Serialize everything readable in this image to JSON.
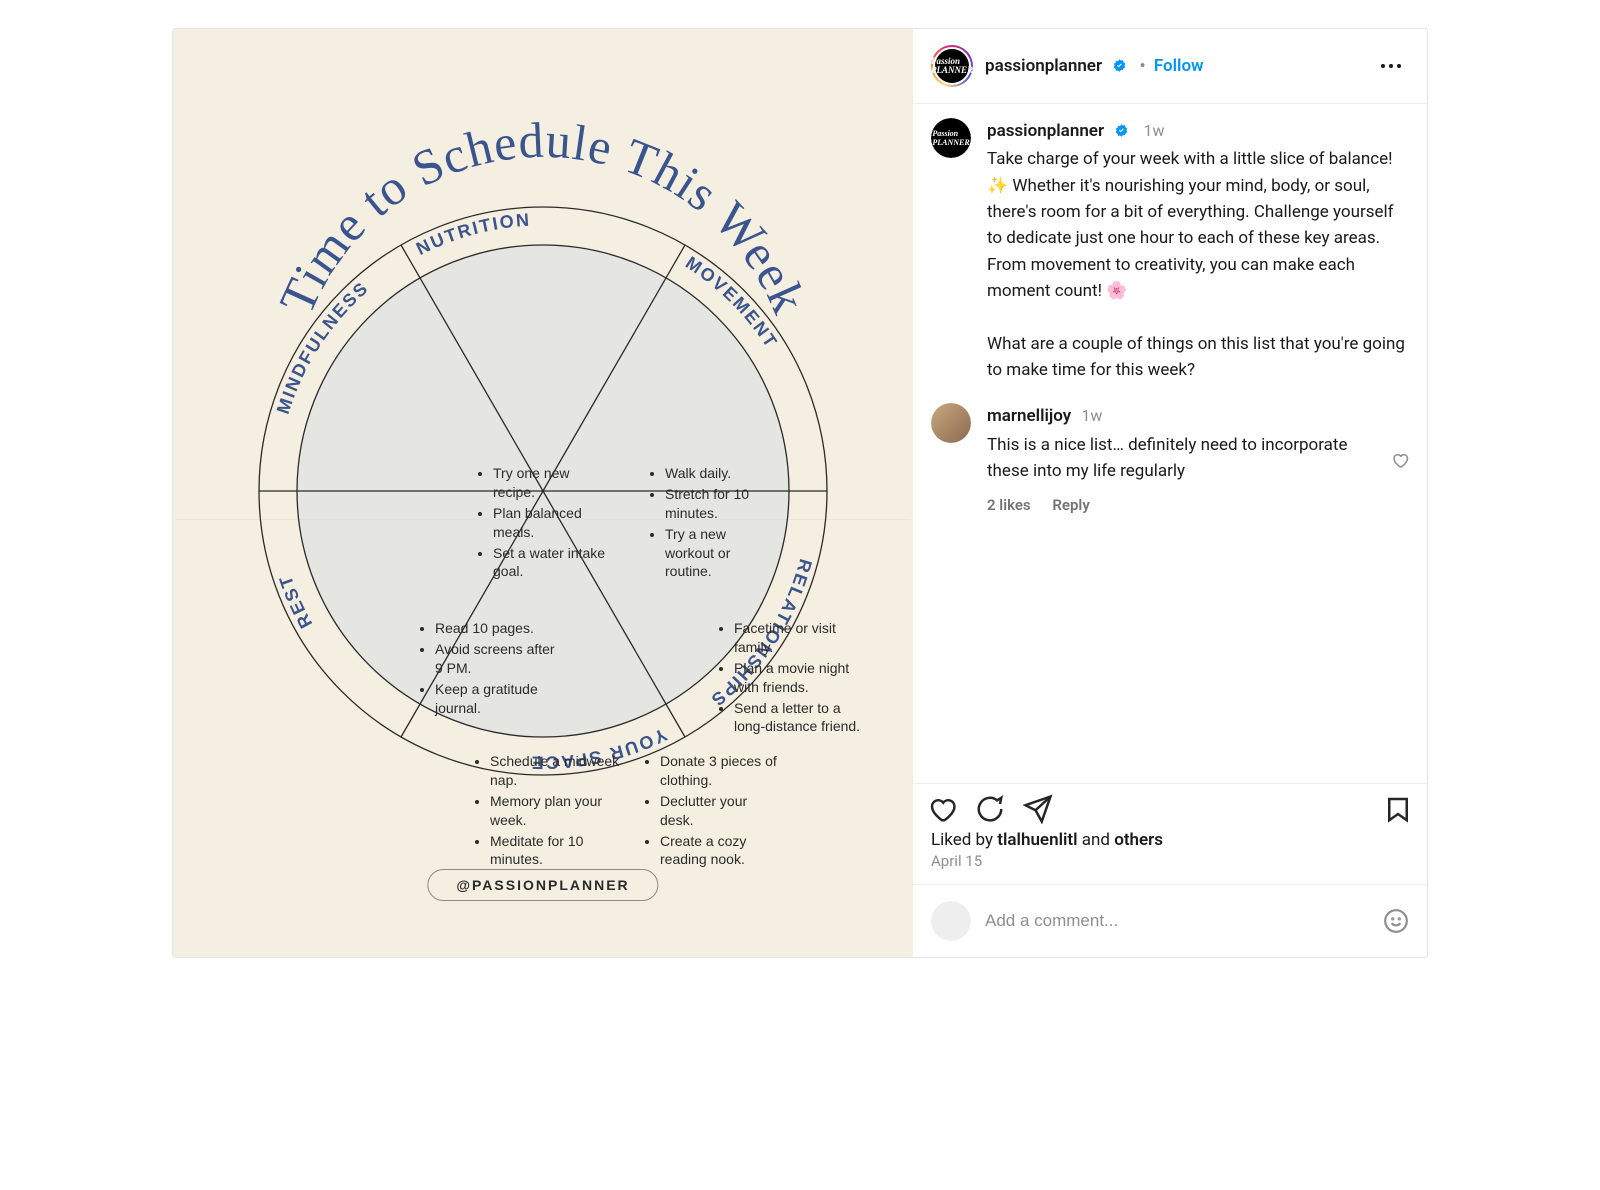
{
  "header": {
    "username": "passionplanner",
    "follow": "Follow",
    "avatar_text": "Passion PLANNER"
  },
  "image": {
    "title": "Time to Schedule This Week",
    "handle": "@PASSIONPLANNER",
    "segments": {
      "nutrition": {
        "label": "NUTRITION",
        "items": [
          "Try one new recipe.",
          "Plan balanced meals.",
          "Set a water intake goal."
        ]
      },
      "movement": {
        "label": "MOVEMENT",
        "items": [
          "Walk daily.",
          "Stretch for 10 minutes.",
          "Try a new workout or routine."
        ]
      },
      "relationships": {
        "label": "RELATIONSHIPS",
        "items": [
          "Facetime or visit family.",
          "Plan a movie night with friends.",
          "Send a letter to a long-distance friend."
        ]
      },
      "yourspace": {
        "label": "YOUR SPACE",
        "items": [
          "Donate 3 pieces of clothing.",
          "Declutter your desk.",
          "Create a cozy reading nook."
        ]
      },
      "rest": {
        "label": "REST",
        "items": [
          "Schedule a midweek nap.",
          "Memory plan your week.",
          "Meditate for 10 minutes."
        ]
      },
      "mindfulness": {
        "label": "MINDFULNESS",
        "items": [
          "Read 10 pages.",
          "Avoid screens after 9 PM.",
          "Keep a gratitude journal."
        ]
      }
    }
  },
  "caption": {
    "username": "passionplanner",
    "timestamp": "1w",
    "body_p1": "Take charge of your week with a little slice of balance! ✨ Whether it's nourishing your mind, body, or soul, there's room for a bit of everything. Challenge yourself to dedicate just one hour to each of these key areas. From movement to creativity, you can make each moment count! 🌸",
    "body_p2": "What are a couple of things on this list that you're going to make time for this week?"
  },
  "comment": {
    "username": "marnellijoy",
    "timestamp": "1w",
    "body": "This is a nice list… definitely need to incorporate these into my life regularly",
    "likes": "2 likes",
    "reply": "Reply"
  },
  "likes_line": {
    "prefix": "Liked by ",
    "user": "tlalhuenlitl",
    "mid": " and ",
    "others": "others"
  },
  "date": "April 15",
  "add_comment_placeholder": "Add a comment..."
}
